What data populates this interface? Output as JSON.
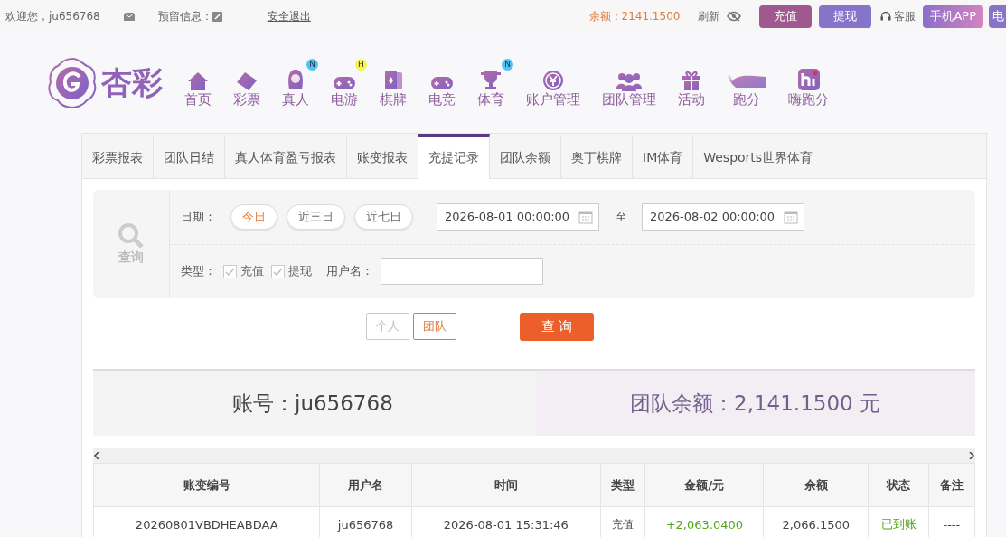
{
  "top_bar": {
    "welcome": "欢迎您，ju656768",
    "message_label": "预留信息：",
    "logout": "安全退出",
    "balance": "余额：2141.1500",
    "refresh": "刷新",
    "buttons": [
      {
        "label": "充值",
        "kind": "deposit"
      },
      {
        "label": "提现",
        "kind": "withdraw"
      }
    ],
    "service": "客服",
    "app_button": "手机APP",
    "cut_button": "电"
  },
  "logo": {
    "text": "杏彩"
  },
  "nav": [
    {
      "label": "首页"
    },
    {
      "label": "彩票"
    },
    {
      "label": "真人",
      "badge": "N",
      "color": "#4fc3f7"
    },
    {
      "label": "电游",
      "badge": "H",
      "color": "#f5f54a"
    },
    {
      "label": "棋牌"
    },
    {
      "label": "电竞"
    },
    {
      "label": "体育",
      "badge": "N",
      "color": "#4fc3f7"
    },
    {
      "label": "账户管理"
    },
    {
      "label": "团队管理"
    },
    {
      "label": "活动"
    },
    {
      "label": "跑分"
    },
    {
      "label": "嗨跑分"
    }
  ],
  "tabs": [
    {
      "label": "彩票报表",
      "selected": false
    },
    {
      "label": "团队日结",
      "selected": false
    },
    {
      "label": "真人体育盈亏报表",
      "selected": false
    },
    {
      "label": "账变报表",
      "selected": false
    },
    {
      "label": "充提记录",
      "selected": true
    },
    {
      "label": "团队余额",
      "selected": false
    },
    {
      "label": "奥丁棋牌",
      "selected": false
    },
    {
      "label": "IM体育",
      "selected": false
    },
    {
      "label": "Wesports世界体育",
      "selected": false
    }
  ],
  "filter": {
    "search_label": "查询",
    "date_label": "日期：",
    "ranges": [
      {
        "label": "今日",
        "selected": true
      },
      {
        "label": "近三日",
        "selected": false
      },
      {
        "label": "近七日",
        "selected": false
      }
    ],
    "start": "2026-08-01 00:00:00",
    "to": "至",
    "end": "2026-08-02 00:00:00",
    "type_label": "类型：",
    "types": [
      {
        "label": "充值",
        "checked": true
      },
      {
        "label": "提现",
        "checked": true
      }
    ],
    "user_label": "用户名："
  },
  "scope": [
    {
      "label": "个人",
      "selected": false
    },
    {
      "label": "团队",
      "selected": true
    }
  ],
  "query_button": "查 询",
  "summary": {
    "account": "账号：ju656768",
    "team_balance": "团队余额：2,141.1500 元"
  },
  "table": {
    "columns": [
      "账变编号",
      "用户名",
      "时间",
      "类型",
      "金额/元",
      "余额",
      "状态",
      "备注"
    ],
    "rows": [
      [
        "20260801VBDHEABDAA",
        "ju656768",
        "2026-08-01 15:31:46",
        "充值",
        "+2,063.0400",
        "2,066.1500",
        "已到账",
        "----"
      ]
    ]
  }
}
